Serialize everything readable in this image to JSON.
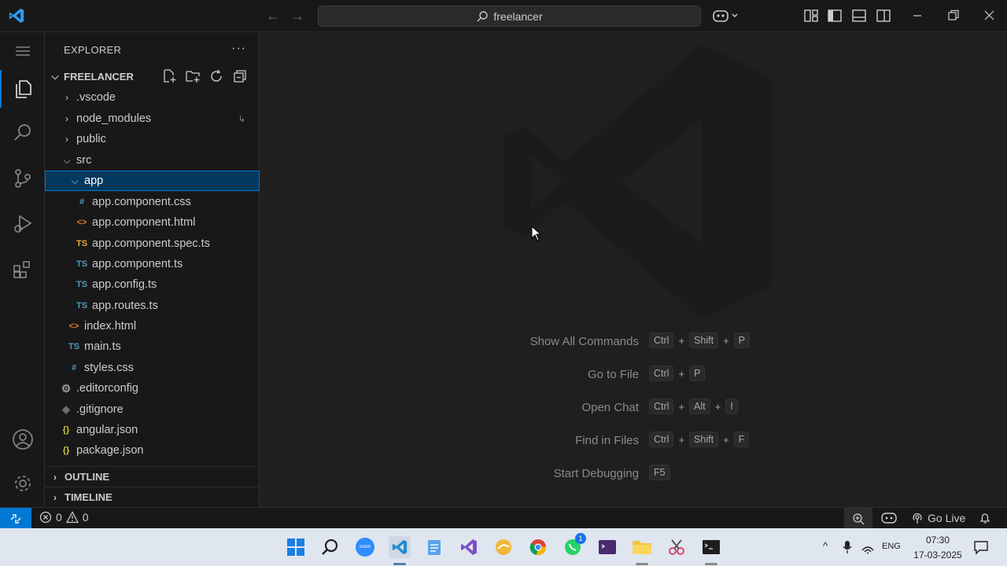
{
  "titlebar": {
    "search_text": "freelancer"
  },
  "sidebar": {
    "title": "EXPLORER",
    "more": "···",
    "root": "FREELANCER",
    "tree": [
      {
        "label": ".vscode",
        "icon": "chevron-right",
        "badge": ""
      },
      {
        "label": "node_modules",
        "icon": "chevron-right",
        "badge": "↳"
      },
      {
        "label": "public",
        "icon": "chevron-right",
        "badge": ""
      },
      {
        "label": "src",
        "icon": "chevron-down",
        "badge": ""
      },
      {
        "label": "app",
        "icon": "chevron-down",
        "badge": ""
      },
      {
        "label": "app.component.css",
        "icon": "#",
        "badge": ""
      },
      {
        "label": "app.component.html",
        "icon": "<>",
        "badge": ""
      },
      {
        "label": "app.component.spec.ts",
        "icon": "TS",
        "badge": ""
      },
      {
        "label": "app.component.ts",
        "icon": "TS",
        "badge": ""
      },
      {
        "label": "app.config.ts",
        "icon": "TS",
        "badge": ""
      },
      {
        "label": "app.routes.ts",
        "icon": "TS",
        "badge": ""
      },
      {
        "label": "index.html",
        "icon": "<>",
        "badge": ""
      },
      {
        "label": "main.ts",
        "icon": "TS",
        "badge": ""
      },
      {
        "label": "styles.css",
        "icon": "#",
        "badge": ""
      },
      {
        "label": ".editorconfig",
        "icon": "gear",
        "badge": ""
      },
      {
        "label": ".gitignore",
        "icon": "diamond",
        "badge": ""
      },
      {
        "label": "angular.json",
        "icon": "{}",
        "badge": ""
      },
      {
        "label": "package.json",
        "icon": "{}",
        "badge": ""
      }
    ],
    "sections": [
      "OUTLINE",
      "TIMELINE"
    ]
  },
  "editor": {
    "shortcuts": [
      {
        "label": "Show All Commands",
        "keys": [
          "Ctrl",
          "Shift",
          "P"
        ]
      },
      {
        "label": "Go to File",
        "keys": [
          "Ctrl",
          "P"
        ]
      },
      {
        "label": "Open Chat",
        "keys": [
          "Ctrl",
          "Alt",
          "I"
        ]
      },
      {
        "label": "Find in Files",
        "keys": [
          "Ctrl",
          "Shift",
          "F"
        ]
      },
      {
        "label": "Start Debugging",
        "keys": [
          "F5"
        ]
      }
    ]
  },
  "statusbar": {
    "errors": "0",
    "warnings": "0",
    "go_live": "Go Live"
  },
  "taskbar": {
    "lang": "ENG",
    "time": "07:30",
    "date": "17-03-2025",
    "whatsapp_badge": "1",
    "zoom_label": "zoom"
  },
  "colors": {
    "accent": "#0078d4",
    "css_icon": "#519aba",
    "html_icon": "#e37933",
    "ts_icon": "#519aba",
    "spec_icon": "#e8a33d",
    "json_icon": "#cbcb41"
  }
}
